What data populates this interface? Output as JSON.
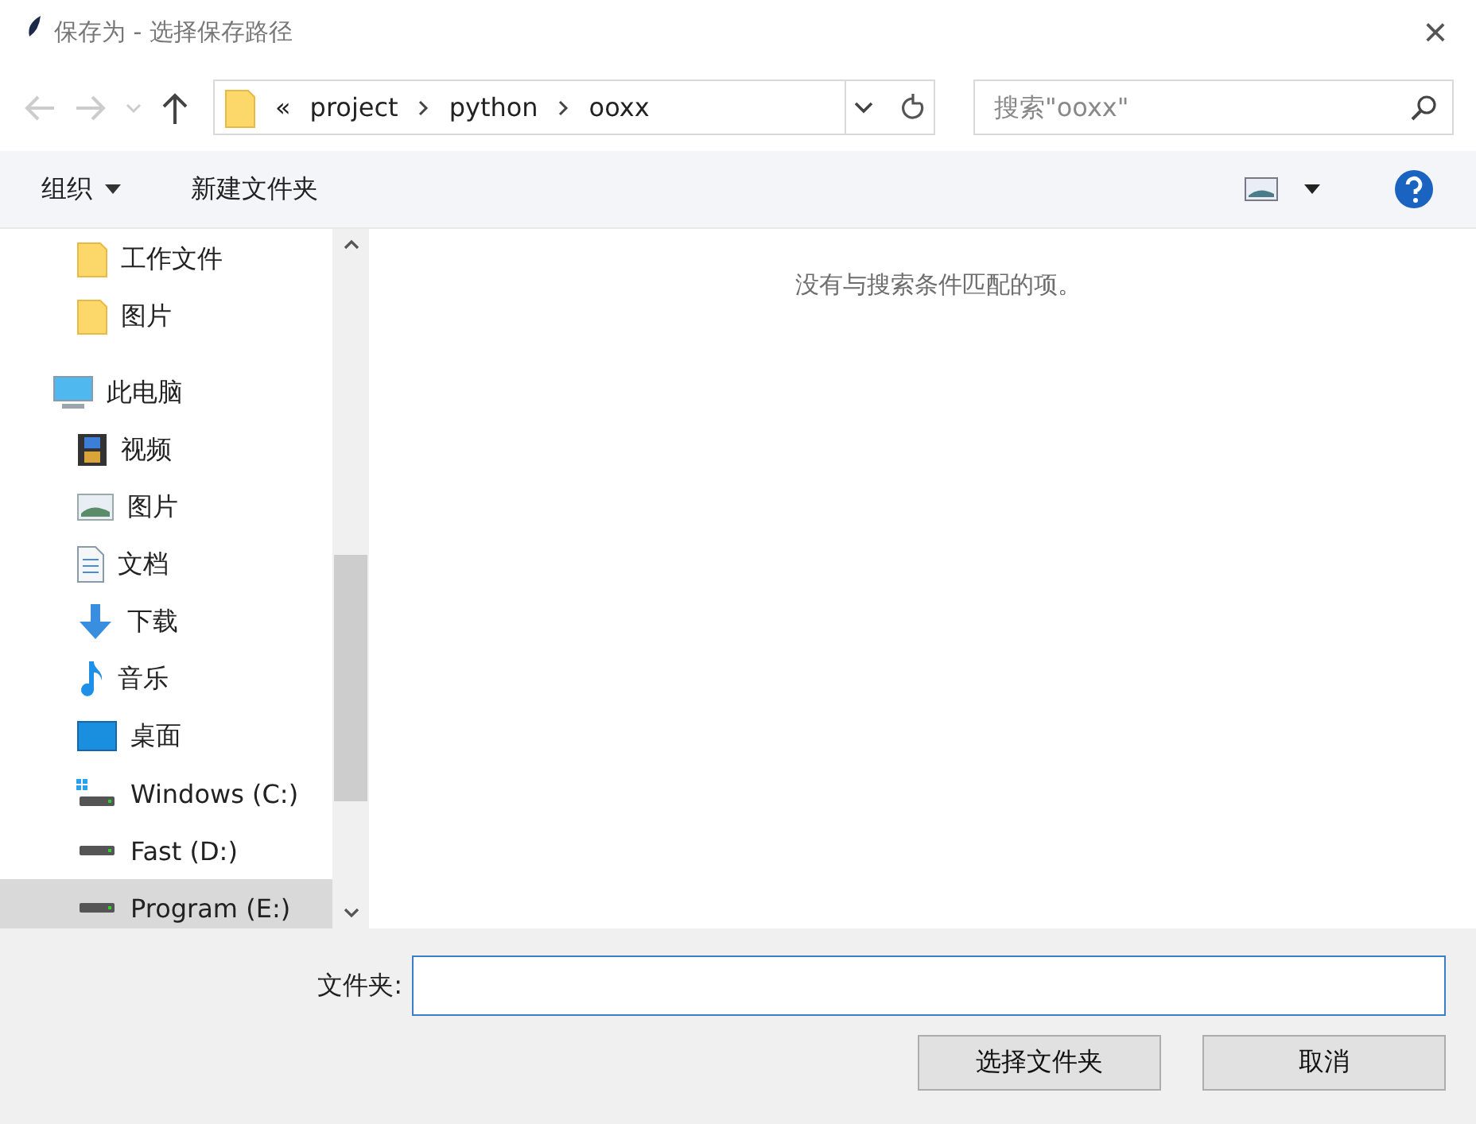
{
  "window": {
    "title": "保存为 - 选择保存路径",
    "close": "×"
  },
  "address": {
    "prefix": "«",
    "crumbs": [
      "project",
      "python",
      "ooxx"
    ]
  },
  "search": {
    "placeholder": "搜索\"ooxx\""
  },
  "toolbar": {
    "organize": "组织",
    "new_folder": "新建文件夹"
  },
  "sidebar": {
    "pinned": [
      {
        "label": "工作文件",
        "kind": "folder",
        "selected": false
      },
      {
        "label": "图片",
        "kind": "folder",
        "selected": false
      }
    ],
    "tree": [
      {
        "label": "此电脑",
        "kind": "pc",
        "selected": false,
        "children": [
          {
            "label": "视频",
            "kind": "video",
            "selected": false
          },
          {
            "label": "图片",
            "kind": "picture",
            "selected": false
          },
          {
            "label": "文档",
            "kind": "doc",
            "selected": false
          },
          {
            "label": "下载",
            "kind": "download",
            "selected": false
          },
          {
            "label": "音乐",
            "kind": "music",
            "selected": false
          },
          {
            "label": "桌面",
            "kind": "desktop",
            "selected": false
          },
          {
            "label": "Windows (C:)",
            "kind": "system-drive",
            "selected": false
          },
          {
            "label": "Fast (D:)",
            "kind": "drive",
            "selected": false
          },
          {
            "label": "Program (E:)",
            "kind": "drive",
            "selected": true
          }
        ]
      }
    ]
  },
  "content": {
    "empty_message": "没有与搜索条件匹配的项。"
  },
  "folder_field": {
    "label": "文件夹:"
  },
  "buttons": [
    "选择文件夹",
    "取消"
  ]
}
